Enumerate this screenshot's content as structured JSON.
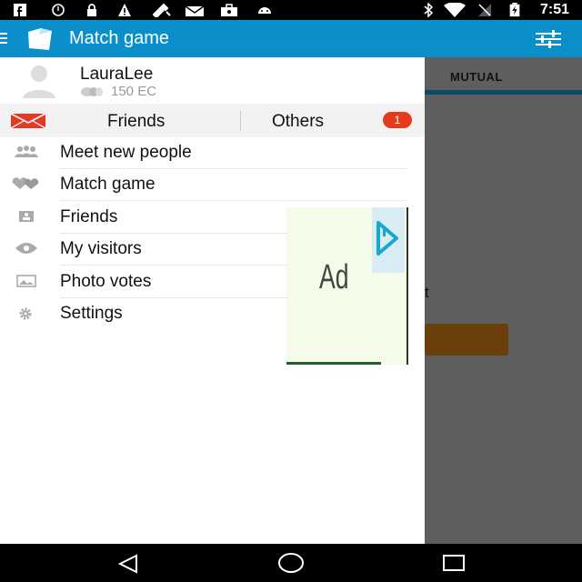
{
  "status_bar": {
    "time": "7:51",
    "icons": [
      "facebook-icon",
      "alarm-icon",
      "lock-icon",
      "warning-icon",
      "satellite-icon",
      "mail-icon",
      "bag-icon",
      "android-icon",
      "bluetooth-icon",
      "wifi-icon",
      "signal-icon",
      "battery-charging-icon"
    ]
  },
  "app_bar": {
    "title": "Match game",
    "menu_icon": "menu-icon",
    "logo_icon": "app-logo-icon",
    "filter_icon": "filter-sliders-icon",
    "color": "#0a8fcb"
  },
  "drawer": {
    "profile": {
      "name": "LauraLee",
      "credits": "150 EC"
    },
    "tabs": {
      "friends": "Friends",
      "others": "Others",
      "badge": "1"
    },
    "menu": [
      {
        "label": "Meet new people",
        "icon": "people-icon"
      },
      {
        "label": "Match game",
        "icon": "hearts-icon"
      },
      {
        "label": "Friends",
        "icon": "contact-card-icon"
      },
      {
        "label": "My visitors",
        "icon": "eye-icon"
      },
      {
        "label": "Photo votes",
        "icon": "photo-icon"
      },
      {
        "label": "Settings",
        "icon": "gear-icon"
      }
    ]
  },
  "background": {
    "tab_label": "MUTUAL",
    "text_fragment": "t"
  },
  "ad": {
    "label": "Ad"
  },
  "nav_bar": {
    "icons": [
      "back-icon",
      "home-icon",
      "recents-icon"
    ]
  }
}
